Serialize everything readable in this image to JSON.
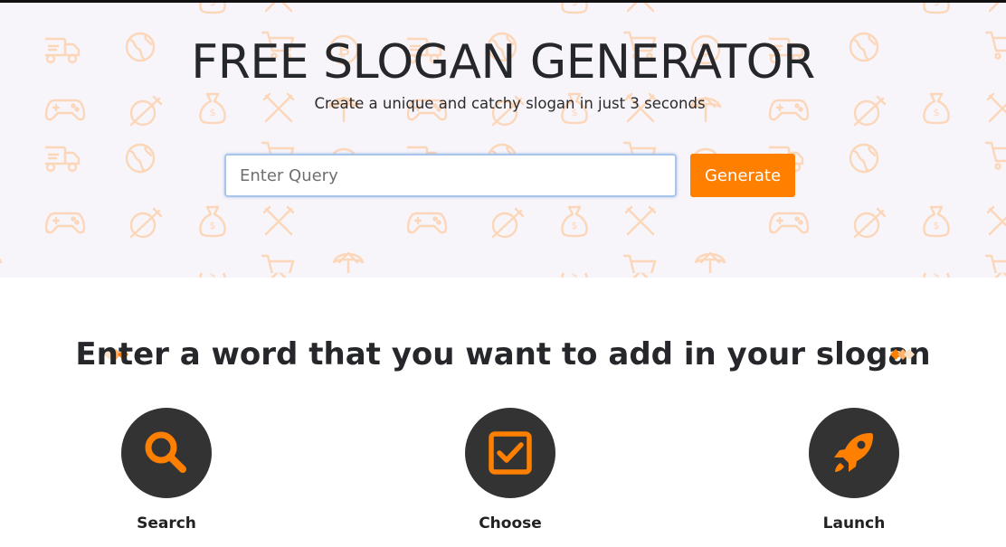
{
  "hero": {
    "title": "FREE SLOGAN GENERATOR",
    "subtitle": "Create a unique and catchy slogan in just 3 seconds",
    "search": {
      "placeholder": "Enter Query",
      "value": ""
    },
    "generate_label": "Generate",
    "pattern_icons": [
      "truck-icon",
      "globe-icon",
      "gamepad-icon",
      "no-food-icon",
      "money-bag-icon",
      "utensils-icon",
      "bitcoin-icon",
      "cart-icon",
      "umbrella-icon"
    ]
  },
  "section": {
    "heading": "Enter a word that you want to add in your slogan"
  },
  "steps": [
    {
      "label": "Search",
      "icon": "search-icon"
    },
    {
      "label": "Choose",
      "icon": "checkbox-icon"
    },
    {
      "label": "Launch",
      "icon": "rocket-icon"
    }
  ],
  "colors": {
    "accent": "#ff7f00",
    "hero_bg": "#f7f5fa",
    "pattern": "#fcd9bf",
    "circle": "#333334",
    "text": "#26272b"
  }
}
